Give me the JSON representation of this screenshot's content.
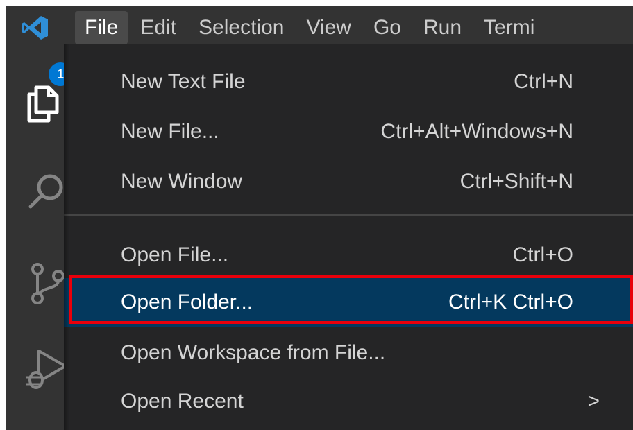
{
  "menubar": {
    "items": [
      {
        "label": "File",
        "active": true
      },
      {
        "label": "Edit"
      },
      {
        "label": "Selection"
      },
      {
        "label": "View"
      },
      {
        "label": "Go"
      },
      {
        "label": "Run"
      },
      {
        "label": "Termi"
      }
    ]
  },
  "activity": {
    "explorer_badge": "1",
    "icons": [
      "explorer-icon",
      "search-icon",
      "source-control-icon",
      "run-debug-icon"
    ]
  },
  "file_menu": {
    "group1": [
      {
        "label": "New Text File",
        "shortcut": "Ctrl+N"
      },
      {
        "label": "New File...",
        "shortcut": "Ctrl+Alt+Windows+N"
      },
      {
        "label": "New Window",
        "shortcut": "Ctrl+Shift+N"
      }
    ],
    "group2": [
      {
        "label": "Open File...",
        "shortcut": "Ctrl+O"
      },
      {
        "label": "Open Folder...",
        "shortcut": "Ctrl+K Ctrl+O",
        "highlighted": true
      },
      {
        "label": "Open Workspace from File...",
        "shortcut": ""
      },
      {
        "label": "Open Recent",
        "shortcut": "",
        "submenu": ">"
      }
    ]
  },
  "colors": {
    "titlebar": "#333333",
    "menu_background": "#252526",
    "highlight": "#04395e",
    "annotation_box": "#e8000b",
    "vscode_blue": "#0078d4"
  }
}
